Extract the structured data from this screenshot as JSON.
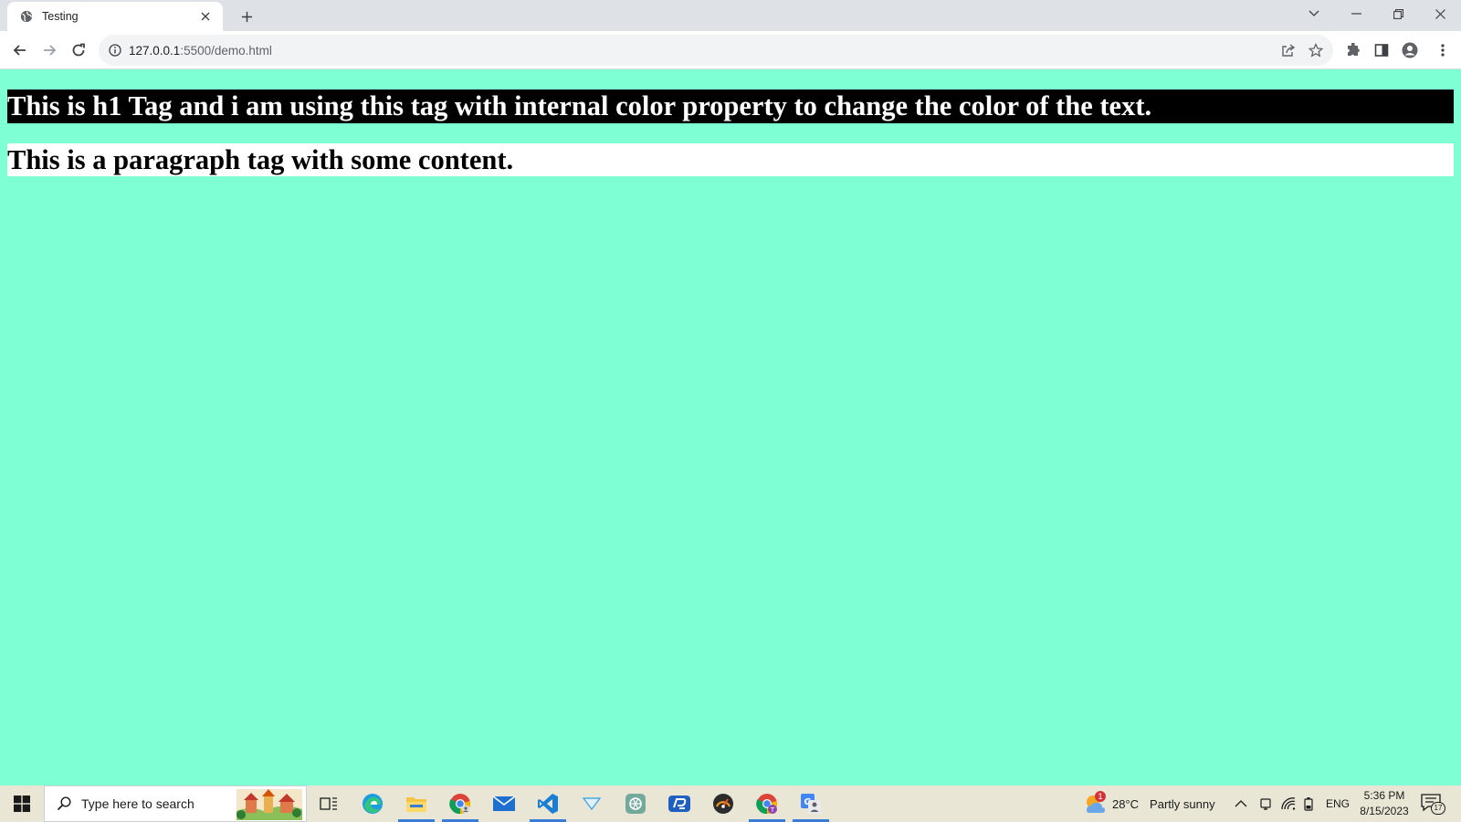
{
  "browser": {
    "tab": {
      "title": "Testing"
    },
    "omnibox": {
      "url_host": "127.0.0.1",
      "url_path": ":5500/demo.html"
    }
  },
  "page": {
    "background": "#7fffd4",
    "heading": "This is h1 Tag and i am using this tag with internal color property to change the color of the text.",
    "paragraph": "This is a paragraph tag with some content."
  },
  "taskbar": {
    "search_placeholder": "Type here to search",
    "weather": {
      "temp": "28°C",
      "condition": "Partly sunny",
      "badge": "1"
    },
    "language": "ENG",
    "time": "5:36 PM",
    "date": "8/15/2023",
    "notifications": "17",
    "apps": [
      "task-view",
      "edge",
      "file-explorer",
      "chrome",
      "mail",
      "vscode",
      "filter-app",
      "chatgpt",
      "remote-app",
      "speedtest-app",
      "chrome-profile",
      "google-translate"
    ]
  }
}
